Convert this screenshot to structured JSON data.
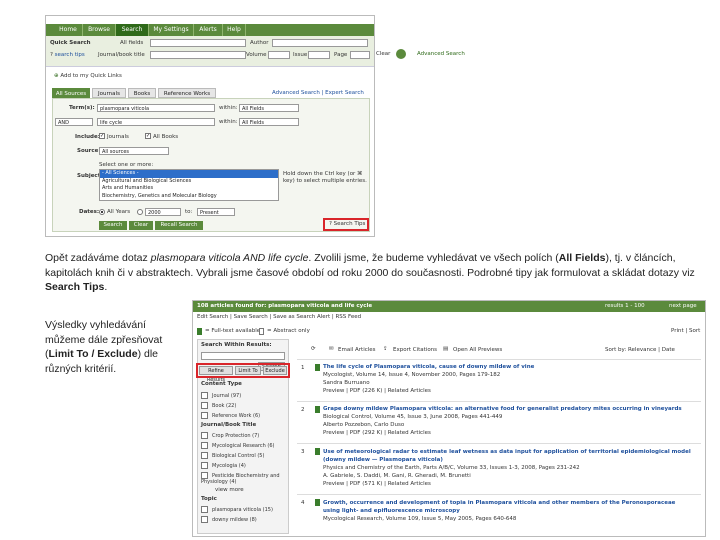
{
  "shot1": {
    "nav_tabs": [
      "Home",
      "Browse",
      "Search",
      "My Settings",
      "Alerts",
      "Help"
    ],
    "active_tab": "Search",
    "quick_search": {
      "label": "Quick Search",
      "all_fields": "All fields",
      "author": "Author",
      "search_tips": "search tips",
      "journal_title": "Journal/book title",
      "volume": "Volume",
      "issue": "Issue",
      "page": "Page",
      "clear": "Clear",
      "advanced": "Advanced Search"
    },
    "quick_links": "Add to my Quick Links",
    "source_tabs": [
      "All Sources",
      "Journals",
      "Books",
      "Reference Works"
    ],
    "advanced_links": "Advanced Search | Expert Search",
    "form": {
      "terms_label": "Term(s):",
      "term1": "plasmopara viticola",
      "within_label": "within:",
      "within1": "All Fields",
      "operator": "AND",
      "term2": "life cycle",
      "within2": "All Fields",
      "include_label": "Include:",
      "include_journals": "Journals",
      "include_books": "All Books",
      "source_label": "Source:",
      "source_value": "All sources",
      "select_hint": "Select one or more:",
      "subject_label": "Subject:",
      "subjects": [
        "- All Sciences -",
        "Agricultural and Biological Sciences",
        "Arts and Humanities",
        "Biochemistry, Genetics and Molecular Biology"
      ],
      "subject_hint": "Hold down the Ctrl key (or ⌘ key) to select multiple entries.",
      "dates_label": "Dates:",
      "all_years": "All Years",
      "year_from": "2000",
      "to_label": "to:",
      "year_to": "Present",
      "search_btn": "Search",
      "clear_btn": "Clear",
      "recall_btn": "Recall Search",
      "search_tips_btn": "Search Tips"
    }
  },
  "text1_parts": [
    "Opět zadáváme dotaz ",
    "plasmopara viticola AND life cycle",
    ". Zvolili jsme, že budeme vyhledávat ve všech polích (",
    "All Fields",
    "), tj. v článcích, kapitolách knih či v abstraktech. Vybrali jsme časové období od roku 2000 do současnosti. Podrobné tipy jak formulovat a skládat dotazy viz ",
    "Search Tips",
    "."
  ],
  "text2_parts": [
    "Výsledky vyhledávání můžeme dále zpřesňovat (",
    "Limit To / Exclude",
    ") dle různých kritérií."
  ],
  "shot2": {
    "header": "108 articles found for: plasmopara viticola and life cycle",
    "header_links": "Edit Search | Save Search | Save as Search Alert | RSS Feed",
    "pagination": "results 1 - 100",
    "next_page": "next page",
    "legend_full": "= Full-text available",
    "legend_abstract": "= Abstract only",
    "sort_by": "Sort by: Relevance | Date",
    "print_label": "Print | Sort",
    "within_label": "Search Within Results:",
    "search_btn": "Search",
    "refine_btns": [
      "Refine Results",
      "Limit To",
      "Exclude"
    ],
    "toolbar": [
      "Email Articles",
      "Export Citations",
      "Open All Previews"
    ],
    "facet_groups": [
      {
        "title": "Content Type",
        "items": [
          "Journal (97)",
          "Book (22)",
          "Reference Work (6)"
        ]
      },
      {
        "title": "Journal/Book Title",
        "items": [
          "Crop Protection (7)",
          "Mycological Research (6)",
          "Biological Control (5)",
          "Mycologia (4)",
          "Pesticide Biochemistry and Physiology (4)"
        ]
      },
      {
        "title": "Topic",
        "items": [
          "plasmopara viticola (15)",
          "downy mildew (8)"
        ]
      }
    ],
    "view_more": "view more",
    "results": [
      {
        "num": "1",
        "title": "The life cycle of Plasmopara viticola, cause of downy mildew of vine",
        "meta": "Mycologist, Volume 14, Issue 4, November 2000, Pages 179-182",
        "author": "Sandra Burruano",
        "links": "Preview | PDF (226 K) | Related Articles"
      },
      {
        "num": "2",
        "title": "Grape downy mildew Plasmopara viticola: an alternative food for generalist predatory mites occurring in vineyards",
        "meta": "Biological Control, Volume 45, Issue 3, June 2008, Pages 441-449",
        "author": "Alberto Pozzebon, Carlo Duso",
        "links": "Preview | PDF (292 K) | Related Articles"
      },
      {
        "num": "3",
        "title": "Use of meteorological radar to estimate leaf wetness as data input for application of territorial epidemiological model (downy mildew — Plasmopara viticola)",
        "meta": "Physics and Chemistry of the Earth, Parts A/B/C, Volume 33, Issues 1-3, 2008, Pages 231-242",
        "author": "A. Gabriele, S. Daddi, M. Gani, R. Gheradi, M. Brunetti",
        "links": "Preview | PDF (571 K) | Related Articles"
      },
      {
        "num": "4",
        "title": "Growth, occurrence and development of topia in Plasmopara viticola and other members of the Peronosporaceae using light- and epifluorescence microscopy",
        "meta": "Mycological Research, Volume 109, Issue 5, May 2005, Pages 640-648",
        "author": "",
        "links": ""
      }
    ]
  },
  "colors": {
    "brand_green": "#5b8a3c",
    "highlight_red": "#d9252a",
    "link_blue": "#1d4f9c"
  }
}
